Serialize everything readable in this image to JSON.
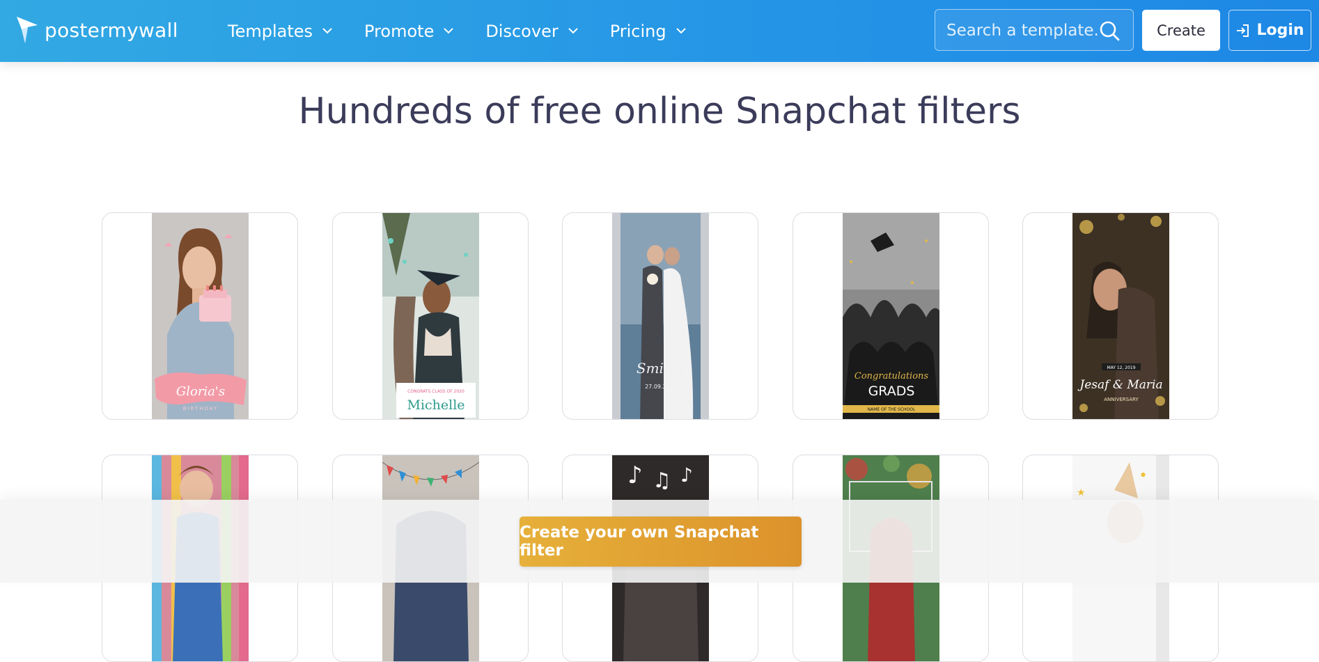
{
  "header": {
    "brand": "postermywall",
    "nav": [
      {
        "label": "Templates"
      },
      {
        "label": "Promote"
      },
      {
        "label": "Discover"
      },
      {
        "label": "Pricing"
      }
    ],
    "search_placeholder": "Search a template...",
    "create_label": "Create",
    "login_label": "Login"
  },
  "page": {
    "title": "Hundreds of free online Snapchat filters"
  },
  "templates": {
    "row1": [
      {
        "name": "Gloria's",
        "caption": "BIRTHDAY"
      },
      {
        "name": "Michelle",
        "caption": "CONGRATS CLASS OF 2020"
      },
      {
        "name": "Smiths",
        "caption": "27.09.2020"
      },
      {
        "name": "GRADS",
        "caption": "Congratulations",
        "footer": "NAME OF THE SCHOOL"
      },
      {
        "name": "Jesaf & Maria",
        "caption": "MAY 12, 2019",
        "footer": "ANNIVERSARY"
      }
    ]
  },
  "cta": {
    "label": "Create your own Snapchat filter"
  },
  "colors": {
    "header_from": "#32a9e3",
    "header_to": "#1e88e5",
    "heading": "#3b3b5a",
    "cta_from": "#e6b03a",
    "cta_to": "#dc922b"
  }
}
